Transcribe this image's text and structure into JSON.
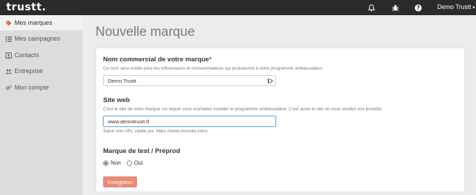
{
  "topbar": {
    "logo": "trustt.",
    "icons": [
      "bell-icon",
      "bug-icon",
      "help-icon"
    ],
    "user_label": "Demo Trustt",
    "caret": "▾"
  },
  "sidebar": {
    "items": [
      {
        "label": "Mes marques",
        "icon": "tag-icon",
        "active": true
      },
      {
        "label": "Mes campagnes",
        "icon": "list-icon",
        "active": false
      },
      {
        "label": "Contacts",
        "icon": "contact-card-icon",
        "active": false
      },
      {
        "label": "Entreprise",
        "icon": "users-icon",
        "active": false
      },
      {
        "label": "Mon compte",
        "icon": "gears-icon",
        "active": false
      }
    ]
  },
  "main": {
    "title": "Nouvelle marque",
    "form": {
      "brand_name": {
        "label": "Nom commercial de votre marque",
        "required_mark": "*",
        "help": "Ce nom sera visible pour les influenceurs et consommateurs qui postuleront à votre programme ambassadeur.",
        "value": "Demo Trustt"
      },
      "website": {
        "label": "Site web",
        "help": "C'est le site de votre marque sur lequel vous souhaitez installer le programme ambassadeur. C'est aussi le site où vous vendez vos produits.",
        "value": "www.demotrustt.fr",
        "hint": "Saisir une URL valide (ex. https://www.monsite.com)"
      },
      "test_mode": {
        "label": "Marque de test / Préprod",
        "options": [
          {
            "label": "Non",
            "checked": true
          },
          {
            "label": "Oui",
            "checked": false
          }
        ]
      },
      "save_label": "Enregistrer"
    }
  },
  "colors": {
    "topbar": "#2b2b2b",
    "sidebar": "#dcdcdc",
    "required": "#e04040",
    "save_button": "#e88a77",
    "radio_checked": "#3a78c8"
  }
}
